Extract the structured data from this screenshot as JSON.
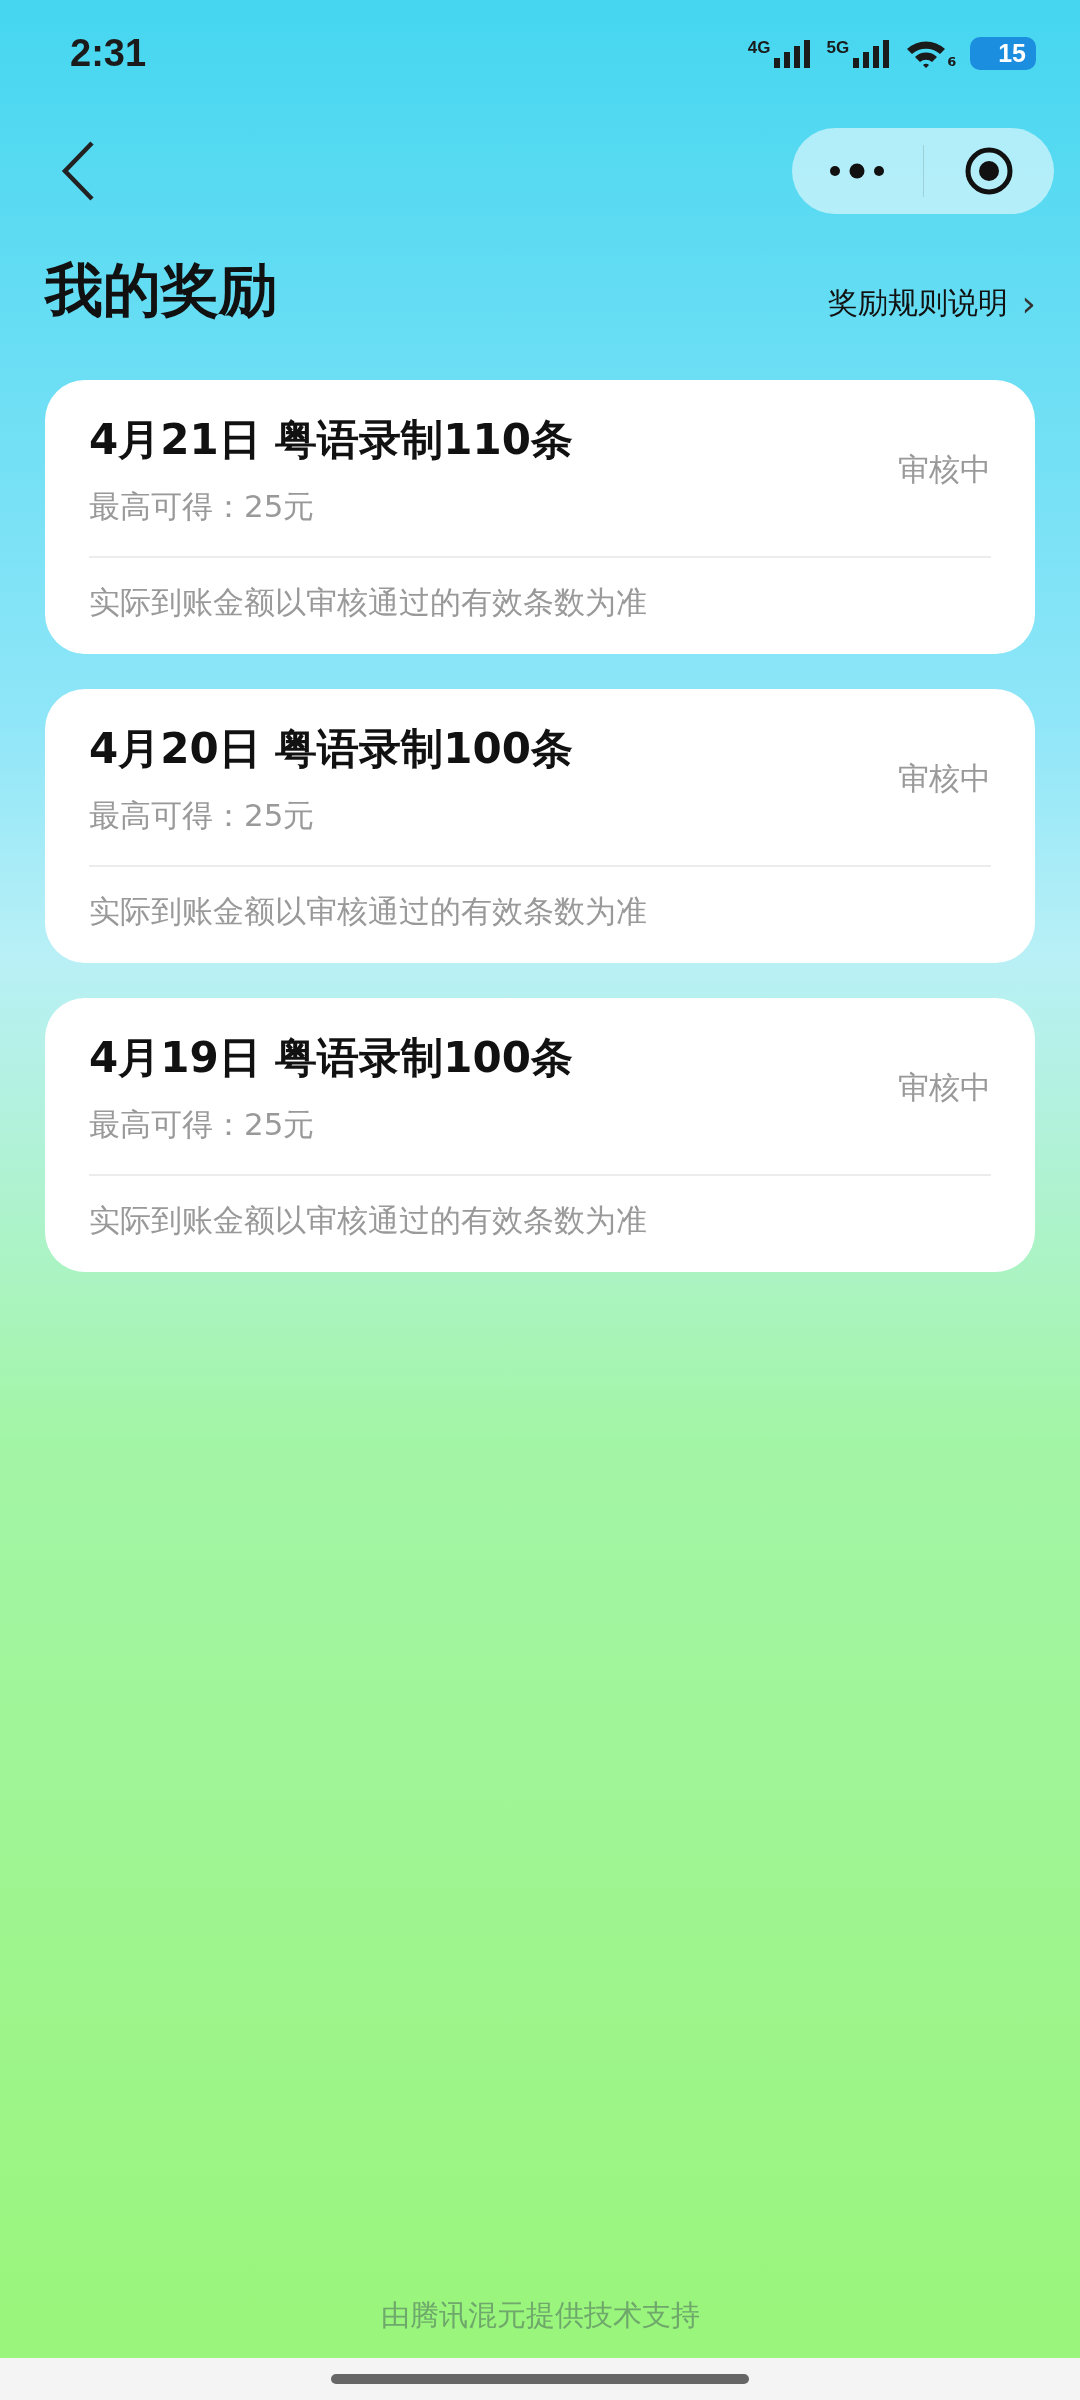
{
  "status_bar": {
    "time": "2:31",
    "network_1": "4G",
    "network_2": "5G",
    "wifi_badge": "6",
    "battery": "15"
  },
  "header": {
    "title": "我的奖励",
    "rules_link": "奖励规则说明",
    "chevron": "›"
  },
  "rewards": [
    {
      "title": "4月21日 粤语录制110条",
      "max": "最高可得：25元",
      "status": "审核中",
      "note": "实际到账金额以审核通过的有效条数为准"
    },
    {
      "title": "4月20日 粤语录制100条",
      "max": "最高可得：25元",
      "status": "审核中",
      "note": "实际到账金额以审核通过的有效条数为准"
    },
    {
      "title": "4月19日 粤语录制100条",
      "max": "最高可得：25元",
      "status": "审核中",
      "note": "实际到账金额以审核通过的有效条数为准"
    }
  ],
  "footer": "由腾讯混元提供技术支持"
}
